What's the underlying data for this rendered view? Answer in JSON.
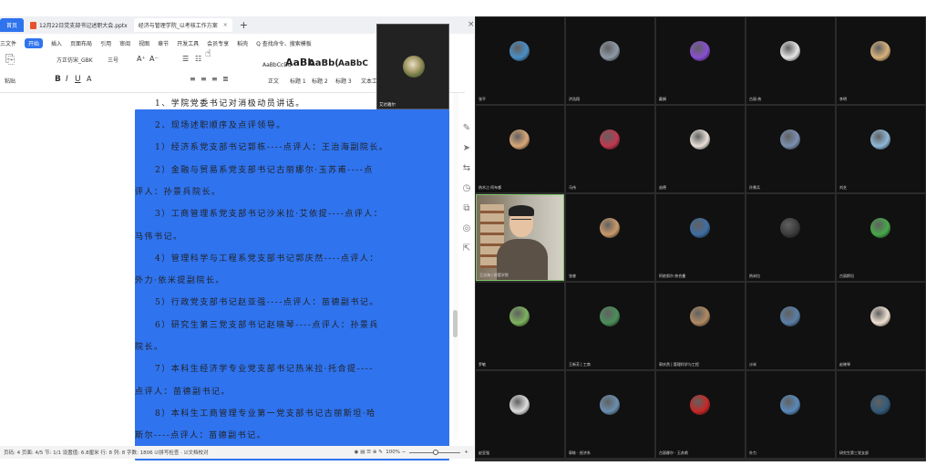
{
  "tabs": {
    "home": "首页",
    "ppt": "12月22日党支部书记述职大会.pptx",
    "doc": "经济与管理学院_以考核工作方案",
    "close": "×",
    "plus": "+"
  },
  "menu": [
    "三文件",
    "开始",
    "插入",
    "页面布局",
    "引用",
    "审阅",
    "视图",
    "章节",
    "开发工具",
    "会员专享",
    "稻壳",
    "Q 查找命令、搜索模板"
  ],
  "ribbon": {
    "paste": "粘贴",
    "font_name": "方正仿宋_GBK",
    "font_size": "三号",
    "styles": [
      {
        "label": "AaBbCcDd",
        "name": "正文"
      },
      {
        "label": "AaBb",
        "name": "标题 1"
      },
      {
        "label": "AaBb(",
        "name": "标题 2"
      },
      {
        "label": "AaBbC",
        "name": "标题 3"
      }
    ],
    "text_tool": "文本工具"
  },
  "document": {
    "lines": [
      "1、学院党委书记对消极动员讲话。",
      "2、现场述职顺序及点评领导。",
      "1）经济系党支部书记郭栋----点评人：王治海副院长。",
      "2）金融与贸易系党支部书记古丽娜尔·玉苏甫----点",
      "评人：孙景兵院长。",
      "3）工商管理系党支部书记沙米拉·艾依提----点评人：",
      "马伟书记。",
      "4）管理科学与工程系党支部书记郭庆然----点评人：",
      "外力·依米提副院长。",
      "5）行政党支部书记赵亚强----点评人：苗德副书记。",
      "6）研究生第三党支部书记赵晓琴----点评人：孙景兵",
      "院长。",
      "7）本科生经济学专业党支部书记热米拉·托合提----",
      "点评人：苗德副书记。",
      "8）本科生工商管理专业第一党支部书记古丽斯坦·哈",
      "斯尔----点评人：苗德副书记。"
    ]
  },
  "status": {
    "left": "页码: 4  页面: 4/5  节: 1/1  设置值: 6.8厘米  行: 8  列: 8  字数: 1806  ☑拼写检查 · ☑文档校对",
    "zoom": "100%"
  },
  "overlay_camera": {
    "name": "艾达雅尔"
  },
  "meeting": {
    "participants": [
      {
        "name": "张平",
        "color": "#4a8fc6"
      },
      {
        "name": "洪浩翔",
        "color": "#8e9aa6"
      },
      {
        "name": "戴娟",
        "color": "#8a4fd1"
      },
      {
        "name": "古丽·热",
        "color": "#e6e6e6"
      },
      {
        "name": "李明",
        "color": "#d9b27c"
      },
      {
        "name": "热木江·阿布都",
        "color": "#d8a878"
      },
      {
        "name": "马伟",
        "color": "#c0384f"
      },
      {
        "name": "苗德",
        "color": "#e8e0d8"
      },
      {
        "name": "孙景兵",
        "color": "#7b8fb0"
      },
      {
        "name": "刘艺",
        "color": "#8fb8d8"
      },
      {
        "name": "王治海 | 经管学院",
        "color": "video"
      },
      {
        "name": "张睿",
        "color": "#c99a6a"
      },
      {
        "name": "阿依努尔·热合曼",
        "color": "#3f6ea3"
      },
      {
        "name": "热米拉",
        "color": "#3b3b3b"
      },
      {
        "name": "古丽斯坦",
        "color": "#47a84a"
      },
      {
        "name": "罗敏",
        "color": "#7db45d"
      },
      {
        "name": "王新芳 | 工商",
        "color": "#4b8f5a"
      },
      {
        "name": "郭庆然 | 管理科学与工程",
        "color": "#b08a63"
      },
      {
        "name": "沙米",
        "color": "#5a7fa6"
      },
      {
        "name": "赵晓琴",
        "color": "#f0e2d2"
      },
      {
        "name": "赵亚强",
        "color": "#ddd"
      },
      {
        "name": "郭栋 · 经济系",
        "color": "#6a8fb0"
      },
      {
        "name": "古丽娜尔 · 玉苏甫",
        "color": "#c62828"
      },
      {
        "name": "外力",
        "color": "#5a89bb"
      },
      {
        "name": "研究生第三党支部",
        "color": "#335a78"
      }
    ]
  }
}
